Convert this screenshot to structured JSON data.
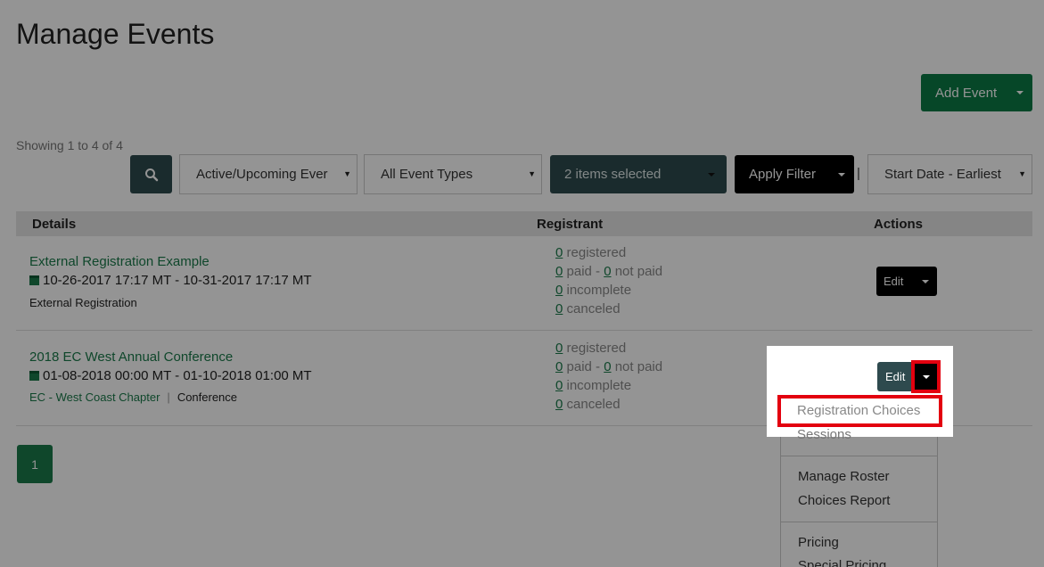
{
  "page": {
    "title": "Manage Events"
  },
  "toolbar": {
    "add_event_label": "Add Event"
  },
  "filters": {
    "showing": "Showing 1 to 4 of 4",
    "status": "Active/Upcoming Ever",
    "event_type": "All Event Types",
    "items_selected": "2 items selected",
    "apply_label": "Apply Filter",
    "separator": "|",
    "sort": "Start Date - Earliest"
  },
  "table": {
    "headers": {
      "details": "Details",
      "registrant": "Registrant",
      "actions": "Actions"
    },
    "rows": [
      {
        "name": "External Registration Example",
        "dates": "10-26-2017 17:17 MT - 10-31-2017 17:17 MT",
        "chapter": "",
        "type": "External Registration",
        "registered": "0",
        "registered_label": " registered",
        "paid": "0",
        "paid_label": " paid - ",
        "not_paid": "0",
        "not_paid_label": " not paid",
        "incomplete": "0",
        "incomplete_label": " incomplete",
        "canceled": "0",
        "canceled_label": " canceled",
        "edit_label": "Edit"
      },
      {
        "name": "2018 EC West Annual Conference",
        "dates": "01-08-2018 00:00 MT - 01-10-2018 01:00 MT",
        "chapter": "EC - West Coast Chapter",
        "separator": "|",
        "type": "Conference",
        "registered": "0",
        "registered_label": " registered",
        "paid": "0",
        "paid_label": " paid - ",
        "not_paid": "0",
        "not_paid_label": " not paid",
        "incomplete": "0",
        "incomplete_label": " incomplete",
        "canceled": "0",
        "canceled_label": " canceled",
        "edit_label": "Edit"
      }
    ]
  },
  "pagination": {
    "current": "1"
  },
  "dropdown": {
    "items": [
      "Registration Choices",
      "Sessions",
      "Manage Roster",
      "Choices Report",
      "Pricing",
      "Special Pricing"
    ]
  },
  "colors": {
    "accent_green": "#0b7a46",
    "highlight_red": "#e3000f",
    "dark_button": "#2e4a4e"
  }
}
